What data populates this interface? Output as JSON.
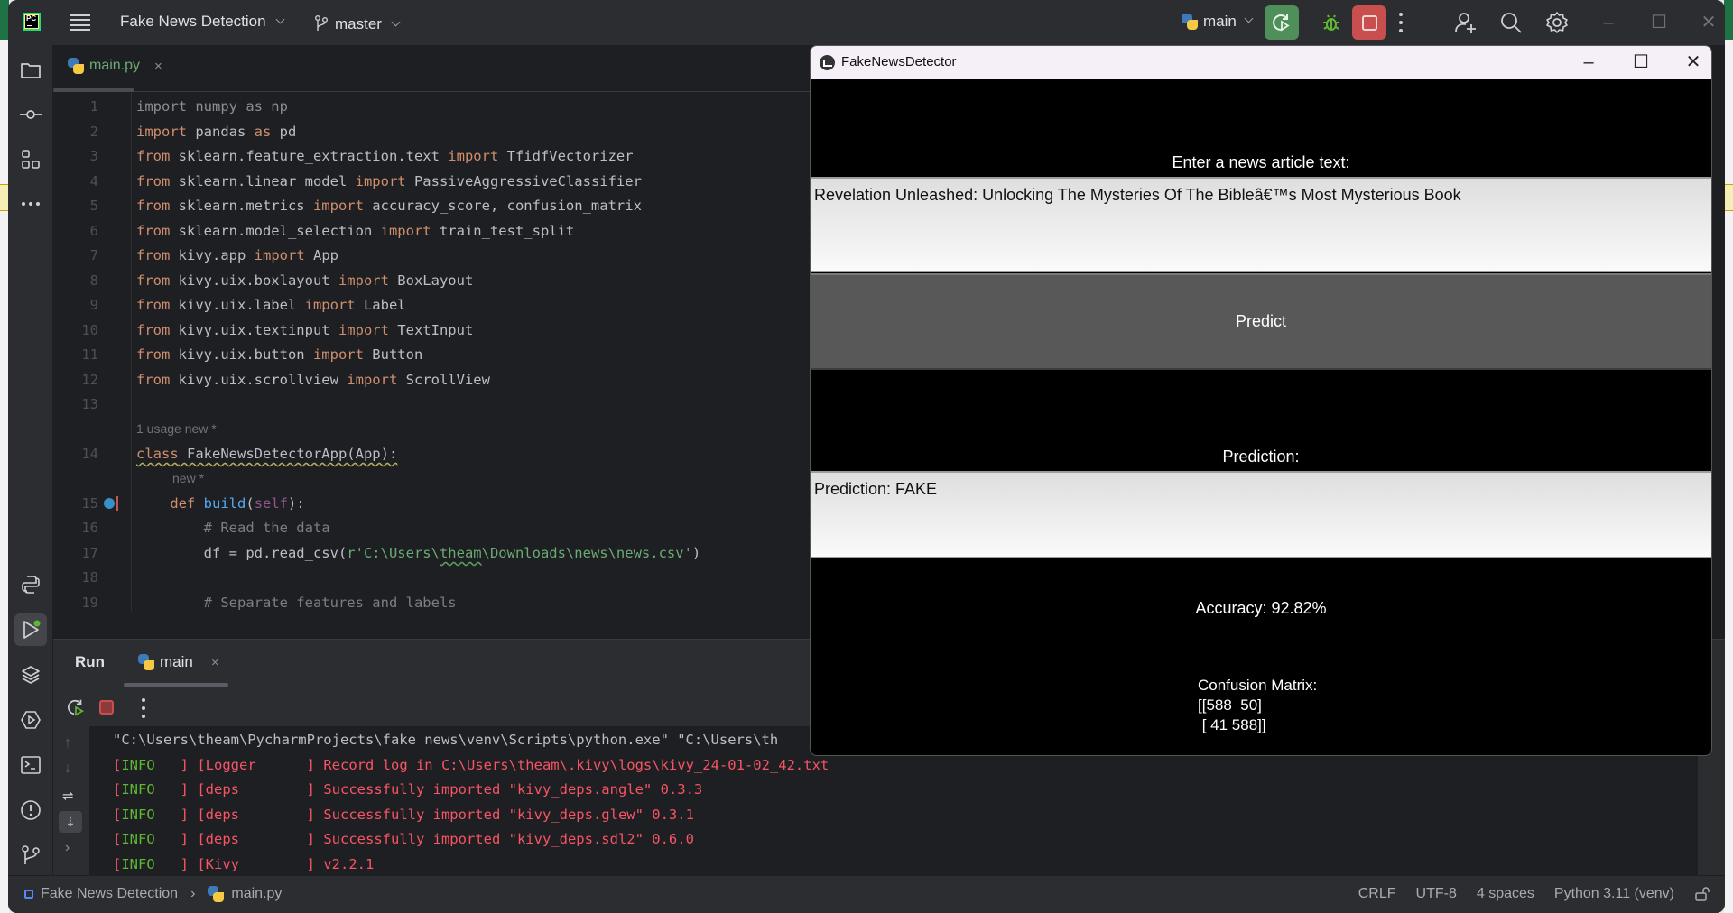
{
  "ide": {
    "project_name": "Fake News Detection",
    "branch": "master",
    "run_config": "main",
    "toolbar_icons": [
      "rerun-icon",
      "debug-icon",
      "stop-icon",
      "more-icon",
      "add-user-icon",
      "search-icon",
      "settings-icon"
    ],
    "window_controls": {
      "minimize": "–",
      "maximize": "☐",
      "close": "✕"
    },
    "editor_tab": {
      "label": "main.py",
      "close": "×"
    },
    "code_lines": [
      {
        "n": "1",
        "text": "import numpy as np"
      },
      {
        "n": "2",
        "text": "import pandas as pd"
      },
      {
        "n": "3",
        "text": "from sklearn.feature_extraction.text import TfidfVectorizer"
      },
      {
        "n": "4",
        "text": "from sklearn.linear_model import PassiveAggressiveClassifier"
      },
      {
        "n": "5",
        "text": "from sklearn.metrics import accuracy_score, confusion_matrix"
      },
      {
        "n": "6",
        "text": "from sklearn.model_selection import train_test_split"
      },
      {
        "n": "7",
        "text": "from kivy.app import App"
      },
      {
        "n": "8",
        "text": "from kivy.uix.boxlayout import BoxLayout"
      },
      {
        "n": "9",
        "text": "from kivy.uix.label import Label"
      },
      {
        "n": "10",
        "text": "from kivy.uix.textinput import TextInput"
      },
      {
        "n": "11",
        "text": "from kivy.uix.button import Button"
      },
      {
        "n": "12",
        "text": "from kivy.uix.scrollview import ScrollView"
      },
      {
        "n": "13",
        "text": ""
      },
      {
        "n": "14",
        "text": "class FakeNewsDetectorApp(App):"
      },
      {
        "n": "15",
        "text": "    def build(self):"
      },
      {
        "n": "16",
        "text": "        # Read the data"
      },
      {
        "n": "17",
        "text": "        df = pd.read_csv(r'C:\\Users\\theam\\Downloads\\news\\news.csv')"
      },
      {
        "n": "18",
        "text": ""
      },
      {
        "n": "19",
        "text": "        # Separate features and labels"
      }
    ],
    "hints": {
      "class_usage": "1 usage  new *",
      "def_hint": "new *"
    },
    "run_panel": {
      "title": "Run",
      "tab": "main",
      "tab_close": "×",
      "console_lines": [
        {
          "type": "cmd",
          "text": "\"C:\\Users\\theam\\PycharmProjects\\fake news\\venv\\Scripts\\python.exe\" \"C:\\Users\\th"
        },
        {
          "type": "log",
          "level": "INFO",
          "tag": "Logger",
          "msg": "Record log in C:\\Users\\theam\\.kivy\\logs\\kivy_24-01-02_42.txt"
        },
        {
          "type": "log",
          "level": "INFO",
          "tag": "deps",
          "msg": "Successfully imported \"kivy_deps.angle\" 0.3.3"
        },
        {
          "type": "log",
          "level": "INFO",
          "tag": "deps",
          "msg": "Successfully imported \"kivy_deps.glew\" 0.3.1"
        },
        {
          "type": "log",
          "level": "INFO",
          "tag": "deps",
          "msg": "Successfully imported \"kivy_deps.sdl2\" 0.6.0"
        },
        {
          "type": "log",
          "level": "INFO",
          "tag": "Kivy",
          "msg": "v2.2.1"
        }
      ]
    },
    "statusbar": {
      "project": "Fake News Detection",
      "separator": "›",
      "file": "main.py",
      "line_ending": "CRLF",
      "encoding": "UTF-8",
      "indent": "4 spaces",
      "interpreter": "Python 3.11 (venv)"
    }
  },
  "kivy_app": {
    "window_title": "FakeNewsDetector",
    "window_controls": {
      "minimize": "–",
      "maximize": "☐",
      "close": "✕"
    },
    "prompt_label": "Enter a news article text:",
    "article_input_value": "Revelation Unleashed: Unlocking The Mysteries Of The Bibleâ€™s Most Mysterious Book",
    "predict_button": "Predict",
    "prediction_label": "Prediction:",
    "prediction_output": "Prediction: FAKE",
    "accuracy": "Accuracy: 92.82%",
    "confusion_matrix_title": "Confusion Matrix:",
    "confusion_matrix_rows": [
      "[[588  50]",
      " [ 41 588]]"
    ]
  },
  "colors": {
    "ide_bg": "#1e1f22",
    "ide_panel": "#2b2d30",
    "keyword": "#cf8e6d",
    "string": "#6aab73",
    "function": "#56a8f5",
    "log_red": "#f75464",
    "info_green": "#5fb832",
    "rerun_green": "#4e8f5a",
    "stop_red": "#c94f4f"
  }
}
